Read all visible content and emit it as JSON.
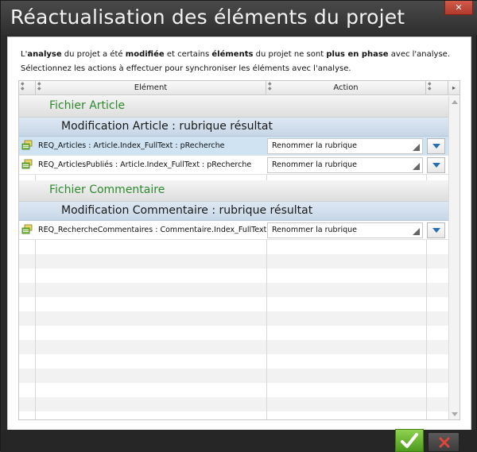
{
  "window": {
    "title": "Réactualisation des éléments du projet",
    "close_label": "✕"
  },
  "intro": {
    "line1_parts": [
      "L'",
      "analyse",
      " du projet a été ",
      "modifiée",
      " et certains ",
      "éléments",
      " du projet ne sont ",
      "plus en phase",
      " avec l'analyse."
    ],
    "line2": "Sélectionnez les actions à effectuer pour synchroniser les éléments avec l'analyse."
  },
  "grid": {
    "columns": [
      "Elément",
      "Action"
    ],
    "groups": [
      {
        "file": "Fichier Article",
        "modification": "Modification Article : rubrique résultat",
        "rows": [
          {
            "element": "REQ_Articles : Article.Index_FullText : pRecherche",
            "action": "Renommer la rubrique",
            "selected": true
          },
          {
            "element": "REQ_ArticlesPubliés : Article.Index_FullText : pRecherche",
            "action": "Renommer la rubrique",
            "selected": false
          }
        ]
      },
      {
        "file": "Fichier Commentaire",
        "modification": "Modification Commentaire : rubrique résultat",
        "rows": [
          {
            "element": "REQ_RechercheCommentaires : Commentaire.Index_FullText : pRecherche",
            "action": "Renommer la rubrique",
            "selected": false
          }
        ]
      }
    ]
  },
  "colors": {
    "file_group_text": "#2d8a2d",
    "selected_row": "#cfe3f3",
    "ok_button": "#6bb535",
    "dropdown_chevron": "#2a6fb5"
  },
  "icons": {
    "row_icon": "query-icon",
    "ok": "checkmark-icon",
    "cancel": "cross-icon",
    "dropdown": "chevron-down-icon"
  }
}
